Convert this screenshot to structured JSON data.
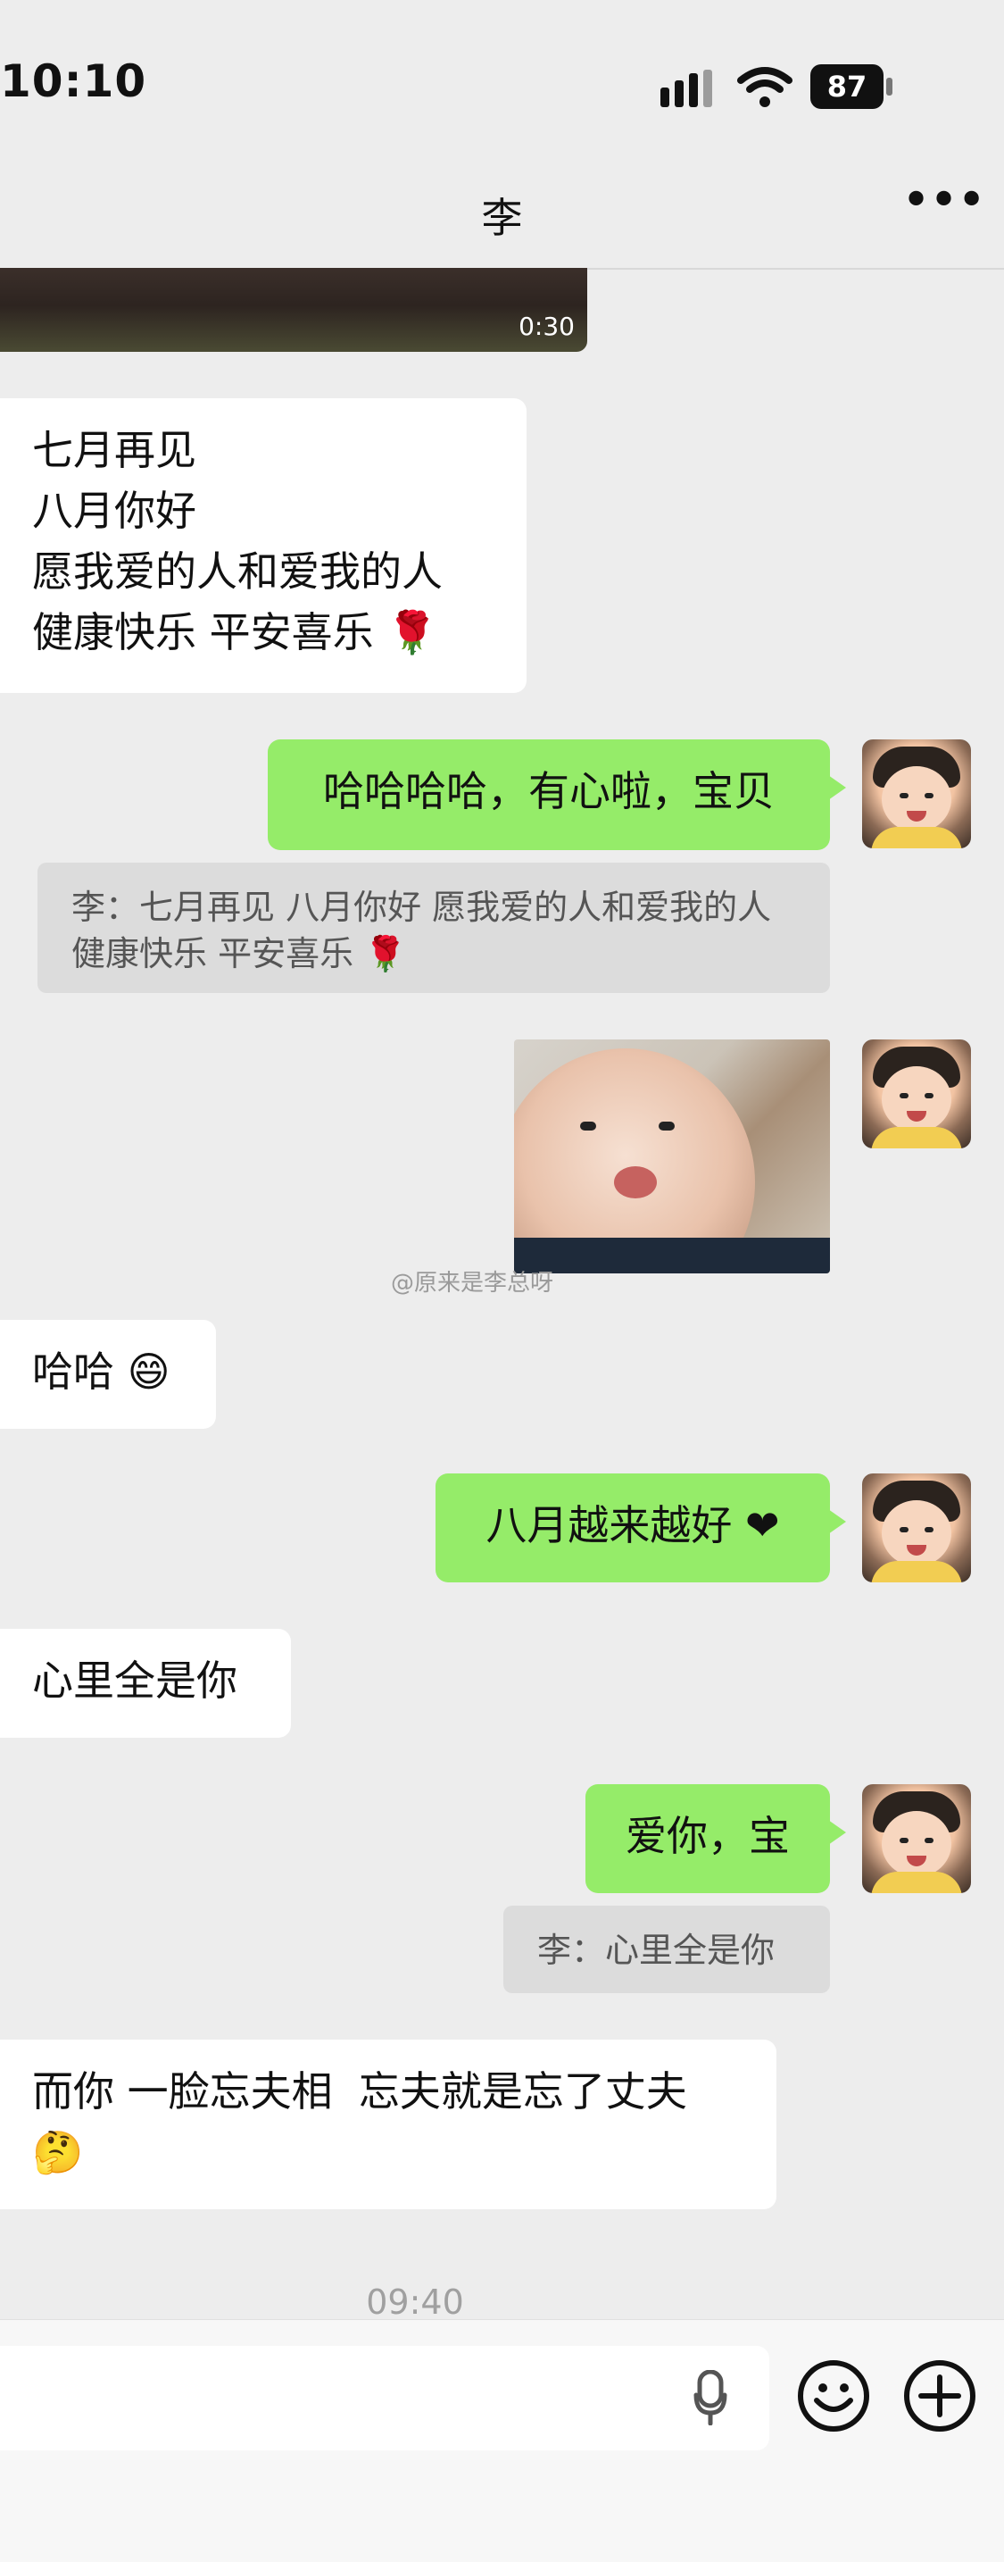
{
  "status_bar": {
    "time": "10:10",
    "battery": "87"
  },
  "header": {
    "title": "李"
  },
  "video": {
    "duration": "0:30"
  },
  "messages": {
    "m1": "七月再见\n八月你好\n愿我爱的人和爱我的人\n健康快乐 平安喜乐 🌹",
    "m2": "哈哈哈哈，有心啦，宝贝",
    "q2": "李：七月再见 八月你好 愿我爱的人和爱我的人 健康快乐 平安喜乐 🌹",
    "m3": "哈哈 😄",
    "m4": "八月越来越好 ❤",
    "m5": "心里全是你",
    "m6": "爱你，宝",
    "q6": "李：心里全是你",
    "m7": "而你 一脸忘夫相  忘夫就是忘了丈夫\n🤔"
  },
  "watermark": "@原来是李总呀",
  "timestamp": "09:40",
  "icons": {
    "signal": "signal-icon",
    "wifi": "wifi-icon",
    "battery": "battery-icon",
    "more": "more-icon",
    "mic": "mic-icon",
    "emoji": "emoji-icon",
    "plus": "plus-icon"
  },
  "colors": {
    "background": "#ededed",
    "left_bubble": "#ffffff",
    "right_bubble": "#95ec69",
    "quote": "#dcdcdc"
  }
}
